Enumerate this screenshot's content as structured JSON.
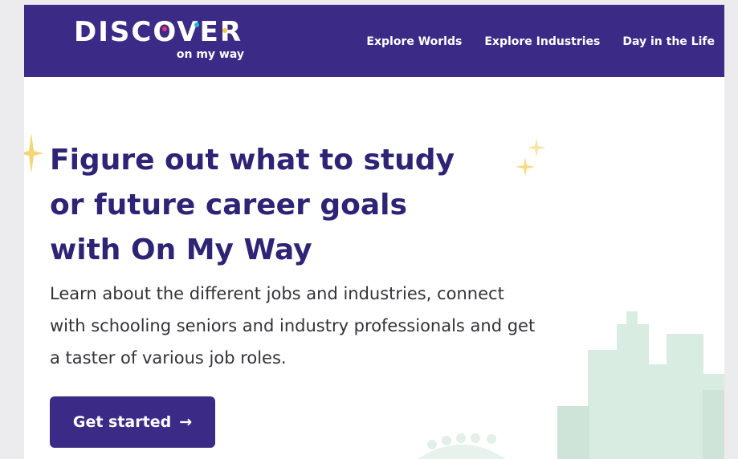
{
  "header": {
    "logo_word": "DISCOVER",
    "logo_tagline": "on my way",
    "nav": [
      {
        "label": "Explore Worlds"
      },
      {
        "label": "Explore Industries"
      },
      {
        "label": "Day in the Life"
      }
    ]
  },
  "hero": {
    "title_lines": [
      "Figure out what to study",
      "or future career goals",
      "with On My Way"
    ],
    "description_lines": [
      "Learn about the different jobs and industries, connect",
      "with schooling seniors and industry professionals and get",
      "a taster of various job roles."
    ],
    "cta_label": "Get started",
    "cta_icon": "arrow-right-icon"
  },
  "colors": {
    "brand": "#3c2b86",
    "title": "#2e2476",
    "body_text": "#333338",
    "sparkle": "#f2cf5c",
    "skyline": "#d9ece1",
    "logo_accents": [
      "#e9317a",
      "#22b8c9",
      "#f5c542"
    ]
  }
}
